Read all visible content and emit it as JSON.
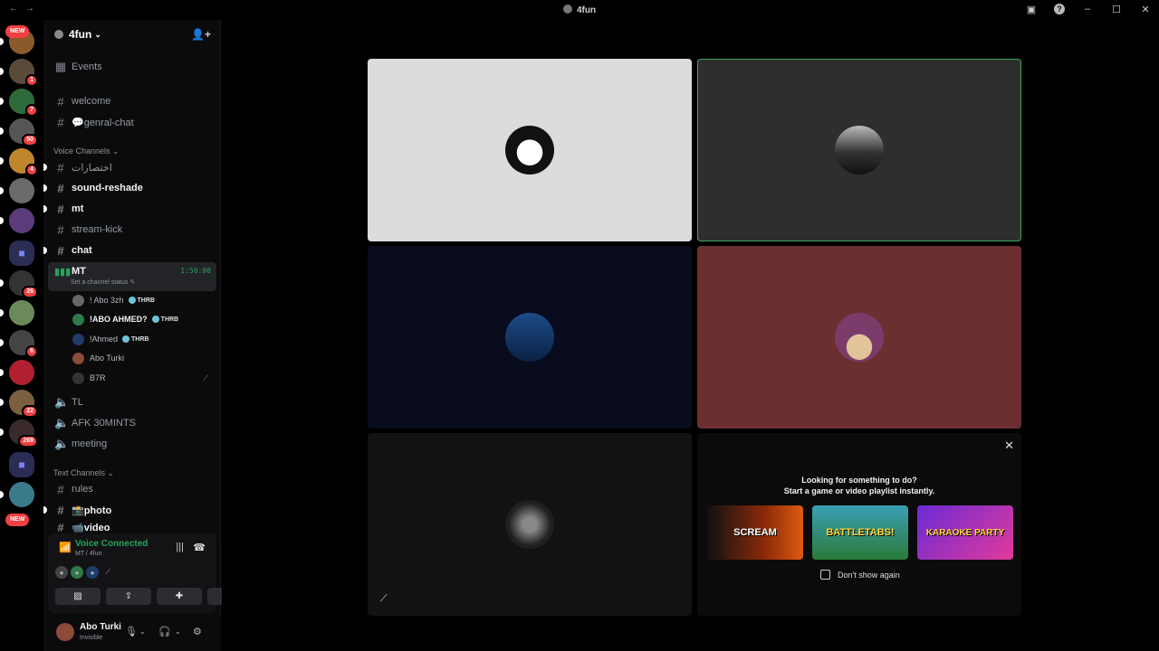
{
  "titlebar": {
    "title": "4fun",
    "back": "←",
    "forward": "→",
    "minimize": "–",
    "maximize": "☐",
    "close": "✕",
    "help": "?"
  },
  "servers": [
    {
      "name": "server-1",
      "badge": "",
      "new": "NEW",
      "color": "#8b5a2b"
    },
    {
      "name": "server-2",
      "badge": "1",
      "color": "#5a4a3a"
    },
    {
      "name": "server-3",
      "badge": "7",
      "color": "#2f6b3a"
    },
    {
      "name": "server-4",
      "badge": "50",
      "color": "#555"
    },
    {
      "name": "server-5",
      "badge": "4",
      "color": "#c0862b"
    },
    {
      "name": "server-6",
      "badge": "",
      "color": "#6a6a6a"
    },
    {
      "name": "server-7",
      "badge": "",
      "color": "#5b3b7a"
    },
    {
      "name": "folder-1",
      "badge": "",
      "color": "#2b2d54",
      "folder": true
    },
    {
      "name": "server-8",
      "badge": "26",
      "color": "#333",
      "label": "R."
    },
    {
      "name": "server-9",
      "badge": "",
      "color": "#6b8a5a"
    },
    {
      "name": "server-10",
      "badge": "6",
      "color": "#444",
      "label": "S"
    },
    {
      "name": "server-11",
      "badge": "",
      "color": "#b02030"
    },
    {
      "name": "server-12",
      "badge": "22",
      "color": "#7a6040"
    },
    {
      "name": "server-13",
      "badge": "269",
      "color": "#3a2a2a"
    },
    {
      "name": "folder-2",
      "badge": "",
      "color": "#2b2d54",
      "folder": true
    },
    {
      "name": "server-14",
      "badge": "",
      "color": "#3a7a8a"
    }
  ],
  "new_label_bottom": "NEW",
  "guild": {
    "name": "4fun"
  },
  "channels": {
    "events": "Events",
    "welcome": "welcome",
    "general": "💬genral-chat",
    "voice_category": "Voice Channels",
    "voice_text": [
      {
        "label": "اختصارات",
        "bold": false,
        "unread": true
      },
      {
        "label": "sound-reshade",
        "bold": true,
        "unread": true
      },
      {
        "label": "mt",
        "bold": true,
        "unread": true
      },
      {
        "label": "stream-kick",
        "bold": false,
        "unread": false
      },
      {
        "label": "chat",
        "bold": true,
        "unread": true
      }
    ],
    "active_voice": {
      "name": "MT",
      "timer": "1:50:00",
      "status": "Set a channel status ✎"
    },
    "voice_users": [
      {
        "name": "! Abo 3zh",
        "tag": "THRB",
        "bright": false
      },
      {
        "name": "!ABO AHMED?",
        "tag": "THRB",
        "bright": true
      },
      {
        "name": "!Ahmed",
        "tag": "THRB",
        "bright": false
      },
      {
        "name": "Abo Turki",
        "tag": "",
        "bright": false
      },
      {
        "name": "B7R",
        "tag": "",
        "bright": false,
        "muted": true
      }
    ],
    "other_voice": [
      "TL",
      "AFK 30MINTS",
      "meeting"
    ],
    "text_category": "Text Channels",
    "text": [
      "rules",
      "📸photo",
      "📹video"
    ]
  },
  "voice_panel": {
    "title": "Voice Connected",
    "subtitle": "MT / 4fun"
  },
  "user": {
    "name": "Abo Turki",
    "status": "Invisible"
  },
  "activity": {
    "line1": "Looking for something to do?",
    "line2": "Start a game or video playlist instantly.",
    "cards": [
      "SCREAM",
      "BATTLETABS!",
      "KARAOKE PARTY"
    ],
    "dont_show": "Don't show again"
  },
  "colors": {
    "speaking": "#3ba55d",
    "online": "#23a55a",
    "badge": "#f23f42"
  }
}
